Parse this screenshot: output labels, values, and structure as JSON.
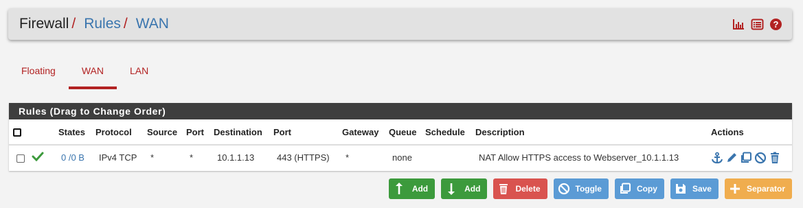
{
  "breadcrumb": {
    "root": "Firewall",
    "sep": "/",
    "level1": "Rules",
    "level2": "WAN"
  },
  "header_icons": [
    "chart-icon",
    "list-icon",
    "help-icon"
  ],
  "tabs": [
    {
      "label": "Floating",
      "active": false
    },
    {
      "label": "WAN",
      "active": true
    },
    {
      "label": "LAN",
      "active": false
    }
  ],
  "panel": {
    "title": "Rules (Drag to Change Order)"
  },
  "table": {
    "headers": [
      "States",
      "Protocol",
      "Source",
      "Port",
      "Destination",
      "Port",
      "Gateway",
      "Queue",
      "Schedule",
      "Description",
      "Actions"
    ],
    "rows": [
      {
        "states": "0 /0 B",
        "protocol": "IPv4 TCP",
        "source": "*",
        "source_port": "*",
        "destination": "10.1.1.13",
        "dest_port": "443 (HTTPS)",
        "gateway": "*",
        "queue": "none",
        "schedule": "",
        "description": "NAT Allow HTTPS access to Webserver_10.1.1.13"
      }
    ]
  },
  "buttons": {
    "add_top": "Add",
    "add_bottom": "Add",
    "delete": "Delete",
    "toggle": "Toggle",
    "copy": "Copy",
    "save": "Save",
    "separator": "Separator"
  },
  "colors": {
    "accent": "#b22222",
    "link": "#3a75ae",
    "green": "#3c9a3c",
    "red": "#d9534f",
    "blue": "#5b9bd5",
    "orange": "#f0ad4e"
  }
}
